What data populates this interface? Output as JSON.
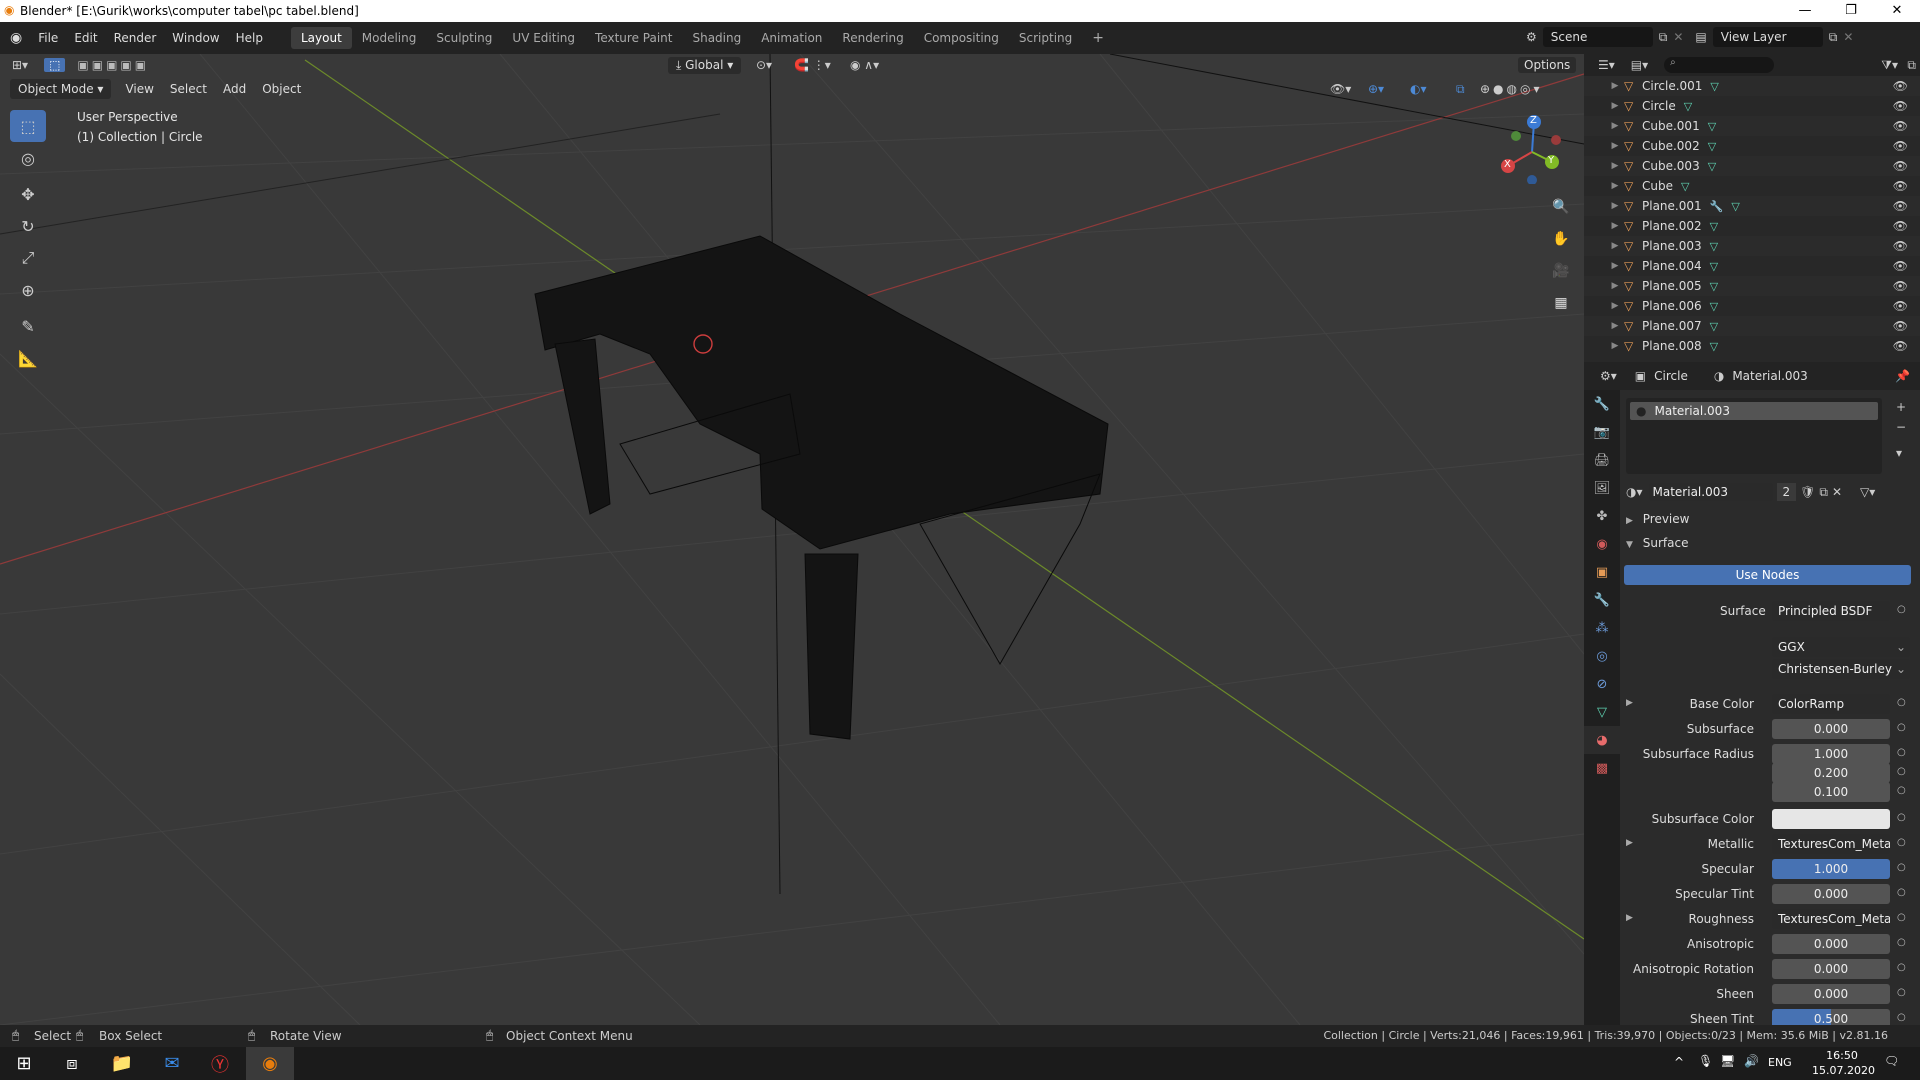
{
  "window": {
    "title": "Blender* [E:\\Gurik\\works\\computer tabel\\pc tabel.blend]"
  },
  "menu": [
    "File",
    "Edit",
    "Render",
    "Window",
    "Help"
  ],
  "workspaces": [
    "Layout",
    "Modeling",
    "Sculpting",
    "UV Editing",
    "Texture Paint",
    "Shading",
    "Animation",
    "Rendering",
    "Compositing",
    "Scripting"
  ],
  "active_workspace": "Layout",
  "scene": "Scene",
  "view_layer": "View Layer",
  "viewport": {
    "transform_orientation": "Global",
    "options_label": "Options",
    "mode": "Object Mode",
    "header_menus": [
      "View",
      "Select",
      "Add",
      "Object"
    ],
    "perspective": "User Perspective",
    "collection_info": "(1) Collection | Circle",
    "gizmo": {
      "x": "X",
      "y": "Y",
      "z": "Z"
    }
  },
  "outliner": {
    "items": [
      {
        "name": "Circle.001",
        "modifier": false
      },
      {
        "name": "Circle",
        "modifier": false
      },
      {
        "name": "Cube.001",
        "modifier": false
      },
      {
        "name": "Cube.002",
        "modifier": false
      },
      {
        "name": "Cube.003",
        "modifier": false
      },
      {
        "name": "Cube",
        "modifier": false
      },
      {
        "name": "Plane.001",
        "modifier": true
      },
      {
        "name": "Plane.002",
        "modifier": false
      },
      {
        "name": "Plane.003",
        "modifier": false
      },
      {
        "name": "Plane.004",
        "modifier": false
      },
      {
        "name": "Plane.005",
        "modifier": false
      },
      {
        "name": "Plane.006",
        "modifier": false
      },
      {
        "name": "Plane.007",
        "modifier": false
      },
      {
        "name": "Plane.008",
        "modifier": false
      }
    ]
  },
  "properties": {
    "breadcrumb_object": "Circle",
    "breadcrumb_material": "Material.003",
    "slot": "Material.003",
    "material_name": "Material.003",
    "users": "2",
    "panel_preview": "Preview",
    "panel_surface": "Surface",
    "use_nodes": "Use Nodes",
    "surface_label": "Surface",
    "surface_value": "Principled BSDF",
    "distribution": "GGX",
    "subsurface_method": "Christensen-Burley",
    "rows": [
      {
        "label": "Base Color",
        "value": "ColorRamp",
        "style": "dark",
        "expand": true
      },
      {
        "label": "Subsurface",
        "value": "0.000",
        "style": "num"
      },
      {
        "label": "Subsurface Radius",
        "value": "1.000",
        "style": "num"
      },
      {
        "label": "",
        "value": "0.200",
        "style": "num"
      },
      {
        "label": "",
        "value": "0.100",
        "style": "num"
      },
      {
        "label": "Subsurface Color",
        "value": "",
        "style": "white"
      },
      {
        "label": "Metallic",
        "value": "TexturesCom_Metal_...",
        "style": "dark",
        "expand": true
      },
      {
        "label": "Specular",
        "value": "1.000",
        "style": "blue"
      },
      {
        "label": "Specular Tint",
        "value": "0.000",
        "style": "num"
      },
      {
        "label": "Roughness",
        "value": "TexturesCom_Metal_...",
        "style": "dark",
        "expand": true
      },
      {
        "label": "Anisotropic",
        "value": "0.000",
        "style": "num"
      },
      {
        "label": "Anisotropic Rotation",
        "value": "0.000",
        "style": "num"
      },
      {
        "label": "Sheen",
        "value": "0.000",
        "style": "num"
      },
      {
        "label": "Sheen Tint",
        "value": "0.500",
        "style": "half"
      }
    ]
  },
  "statusbar": {
    "select": "Select",
    "box_select": "Box Select",
    "rotate_view": "Rotate View",
    "context_menu": "Object Context Menu",
    "stats": "Collection | Circle | Verts:21,046 | Faces:19,961 | Tris:39,970 | Objects:0/23 | Mem: 35.6 MiB | v2.81.16"
  },
  "taskbar": {
    "language": "ENG",
    "time": "16:50",
    "date": "15.07.2020"
  }
}
